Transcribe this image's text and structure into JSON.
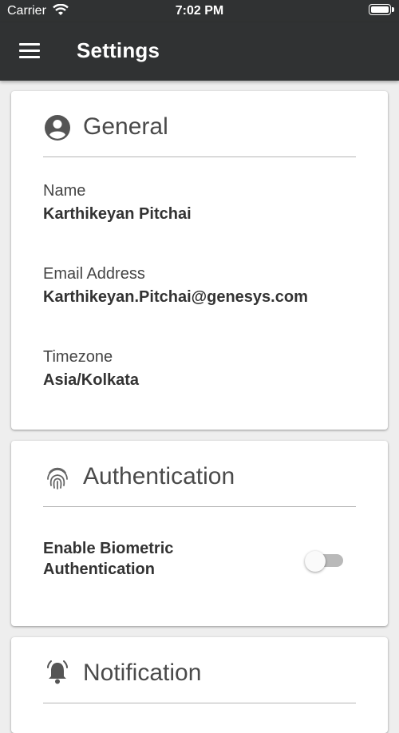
{
  "status_bar": {
    "carrier": "Carrier",
    "time": "7:02 PM"
  },
  "app_bar": {
    "title": "Settings"
  },
  "general": {
    "title": "General",
    "name_label": "Name",
    "name_value": "Karthikeyan Pitchai",
    "email_label": "Email Address",
    "email_value": "Karthikeyan.Pitchai@genesys.com",
    "timezone_label": "Timezone",
    "timezone_value": "Asia/Kolkata"
  },
  "authentication": {
    "title": "Authentication",
    "biometric_label": "Enable Biometric Authentication",
    "biometric_enabled": false
  },
  "notification": {
    "title": "Notification"
  },
  "colors": {
    "app_bar": "#303233",
    "background": "#eeeeee",
    "card": "#ffffff",
    "toggle_track_off": "#b9b9b9"
  }
}
